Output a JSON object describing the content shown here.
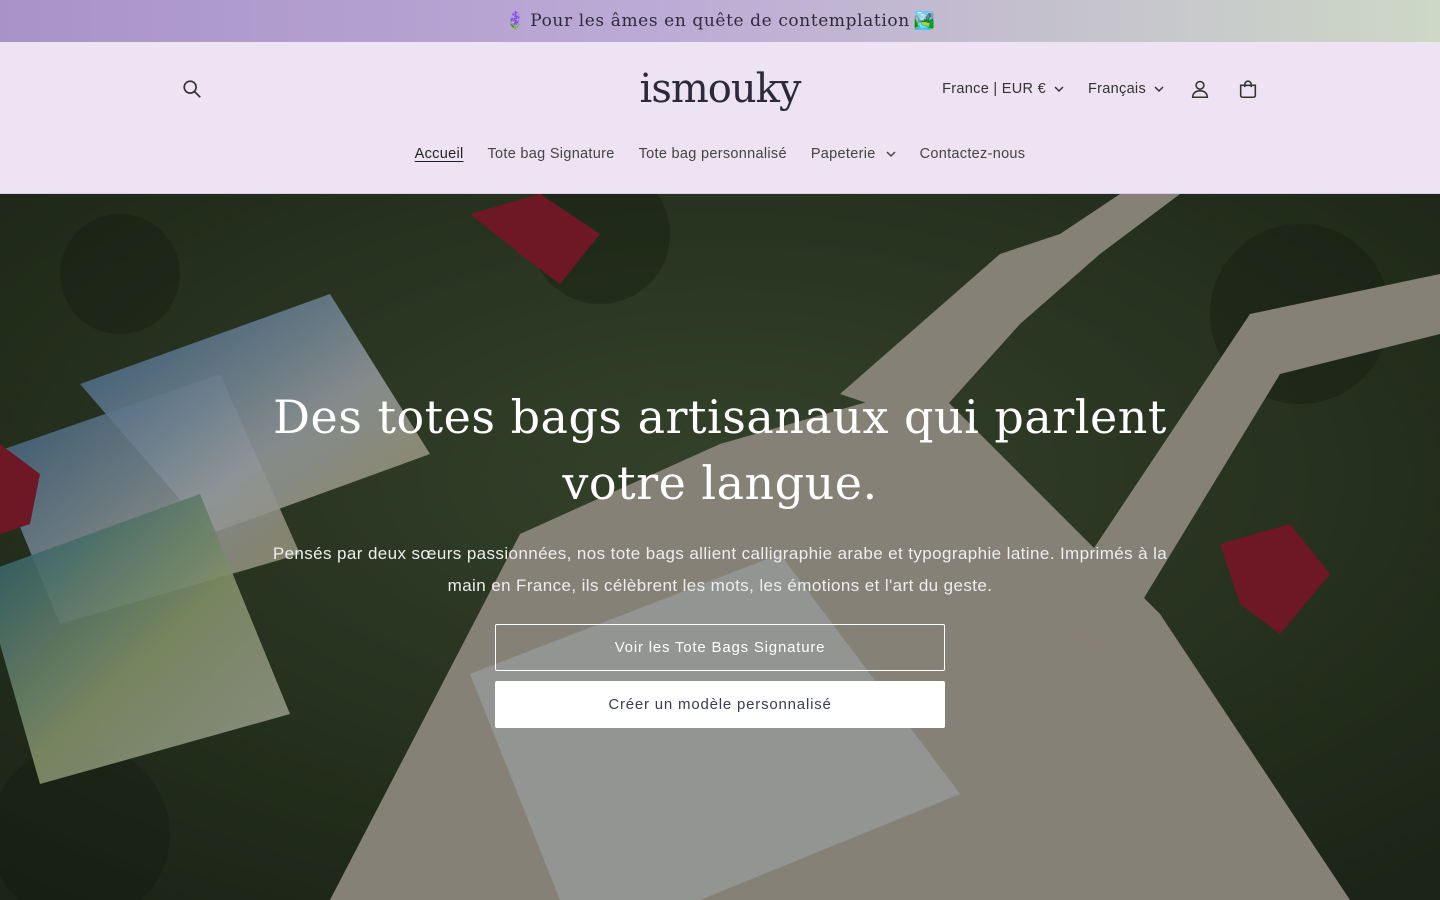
{
  "announcement": {
    "text": "Pour les âmes en quête de contemplation",
    "emoji_left": "🪻",
    "emoji_right": "🏞️"
  },
  "header": {
    "logo": "ismouky",
    "currency": "France | EUR €",
    "language": "Français",
    "icons": [
      "search-icon",
      "account-icon",
      "cart-icon"
    ]
  },
  "nav": {
    "items": [
      {
        "label": "Accueil"
      },
      {
        "label": "Tote bag Signature"
      },
      {
        "label": "Tote bag personnalisé"
      },
      {
        "label": "Papeterie"
      },
      {
        "label": "Contactez-nous"
      }
    ]
  },
  "hero": {
    "title": "Des totes bags artisanaux qui parlent votre langue.",
    "text": "Pensés par deux sœurs passionnées, nos tote bags allient calligraphie arabe et typographie latine. Imprimés à la main en France, ils célèbrent les mots, les émotions et l'art du geste.",
    "button_primary": "Voir les Tote Bags Signature",
    "button_secondary": "Créer un modèle personnalisé"
  },
  "colors": {
    "announcement_bg": "#a992c8",
    "header_bg": "#ede3f2",
    "button_text": "#3a3a5a"
  }
}
